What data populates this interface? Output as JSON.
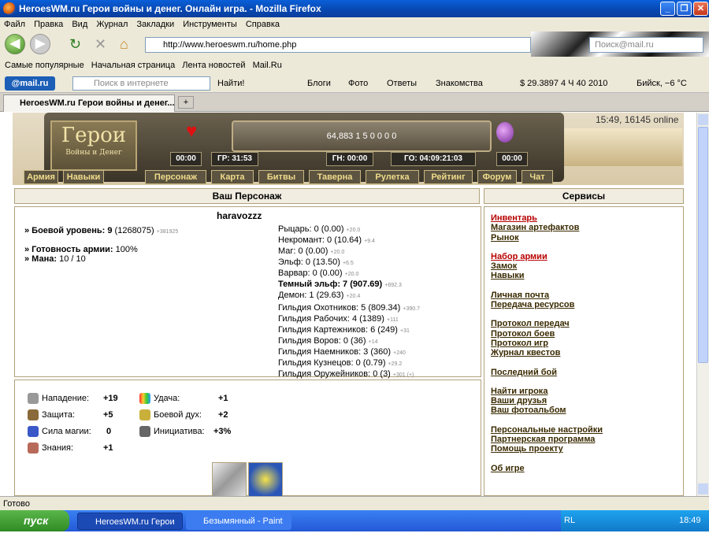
{
  "window": {
    "title": "HeroesWM.ru Герои войны и денег. Онлайн игра. - Mozilla Firefox"
  },
  "menu": [
    "Файл",
    "Правка",
    "Вид",
    "Журнал",
    "Закладки",
    "Инструменты",
    "Справка"
  ],
  "nav": {
    "url": "http://www.heroeswm.ru/home.php",
    "search_placeholder": "Поиск@mail.ru"
  },
  "bookmarks": [
    "Самые популярные",
    "Начальная страница",
    "Лента новостей",
    "Mail.Ru"
  ],
  "mailbar": {
    "brand": "@mail.ru",
    "search_placeholder": "Поиск в интернете",
    "find": "Найти!",
    "links": [
      "Блоги",
      "Фото",
      "Ответы",
      "Знакомства"
    ],
    "rate": "$ 29.3897",
    "date": "4 Ч 40 2010",
    "city": "Бийск, −6 °C"
  },
  "tab": {
    "label": "HeroesWM.ru Герои войны и денег..."
  },
  "game": {
    "logo_big": "Герои",
    "logo_small": "Войны и Денег",
    "online": "15:49, 16145 online",
    "resources": "64,883   1   5   0   0   0   0",
    "timers": [
      "00:00",
      "ГР: 31:53",
      "ГН: 00:00",
      "ГО: 04:09:21:03",
      "00:00"
    ],
    "left_tabs": [
      "Армия",
      "Навыки"
    ],
    "menu": [
      "Персонаж",
      "Карта",
      "Битвы",
      "Таверна",
      "Рулетка",
      "Рейтинг",
      "Форум",
      "Чат"
    ]
  },
  "char": {
    "header": "Ваш Персонаж",
    "name": "haravozzz",
    "level_label": "» Боевой уровень:",
    "level": "9",
    "level_exp": "(1268075)",
    "level_delta": "+381925",
    "ready_label": "» Готовность армии:",
    "ready": "100%",
    "mana_label": "» Мана:",
    "mana": "10 / 10",
    "factions": [
      {
        "name": "Рыцарь: 0 (0.00)",
        "delta": "+20.0"
      },
      {
        "name": "Некромант: 0 (10.64)",
        "delta": "+9.4"
      },
      {
        "name": "Маг: 0 (0.00)",
        "delta": "+20.0"
      },
      {
        "name": "Эльф: 0 (13.50)",
        "delta": "+6.5"
      },
      {
        "name": "Варвар: 0 (0.00)",
        "delta": "+20.0"
      },
      {
        "name": "Темный эльф: 7 (907.69)",
        "delta": "+692.3"
      },
      {
        "name": "Демон: 1 (29.63)",
        "delta": "+20.4"
      }
    ],
    "guilds": [
      {
        "name": "Гильдия Охотников: 5 (809.34)",
        "delta": "+390.7"
      },
      {
        "name": "Гильдия Рабочих: 4 (1389)",
        "delta": "+111"
      },
      {
        "name": "Гильдия Картежников: 6 (249)",
        "delta": "+31"
      },
      {
        "name": "Гильдия Воров: 0 (36)",
        "delta": "+14"
      },
      {
        "name": "Гильдия Наемников: 3 (360)",
        "delta": "+240"
      },
      {
        "name": "Гильдия Кузнецов: 0 (0.79)",
        "delta": "+29.2"
      },
      {
        "name": "Гильдия Оружейников: 0 (3)",
        "delta": "+301 (+)"
      }
    ]
  },
  "stats": [
    {
      "label": "Нападение:",
      "value": "+19"
    },
    {
      "label": "Защита:",
      "value": "+5"
    },
    {
      "label": "Сила магии:",
      "value": "0"
    },
    {
      "label": "Знания:",
      "value": "+1"
    },
    {
      "label": "Удача:",
      "value": "+1"
    },
    {
      "label": "Боевой дух:",
      "value": "+2"
    },
    {
      "label": "Инициатива:",
      "value": "+3%"
    }
  ],
  "services": {
    "header": "Сервисы",
    "groups": [
      [
        "Инвентарь",
        "Магазин артефактов",
        "Рынок"
      ],
      [
        "Набор армии",
        "Замок",
        "Навыки"
      ],
      [
        "Личная почта",
        "Передача ресурсов"
      ],
      [
        "Протокол передач",
        "Протокол боев",
        "Протокол игр",
        "Журнал квестов"
      ],
      [
        "Последний бой"
      ],
      [
        "Найти игрока",
        "Ваши друзья",
        "Ваш фотоальбом"
      ],
      [
        "Персональные настройки",
        "Партнерская программа",
        "Помощь проекту"
      ],
      [
        "Об игре"
      ]
    ]
  },
  "status": "Готово",
  "taskbar": {
    "start": "пуск",
    "tasks": [
      "HeroesWM.ru Герои ...",
      "Безымянный - Paint"
    ],
    "lang": "RL",
    "clock": "18:49"
  }
}
